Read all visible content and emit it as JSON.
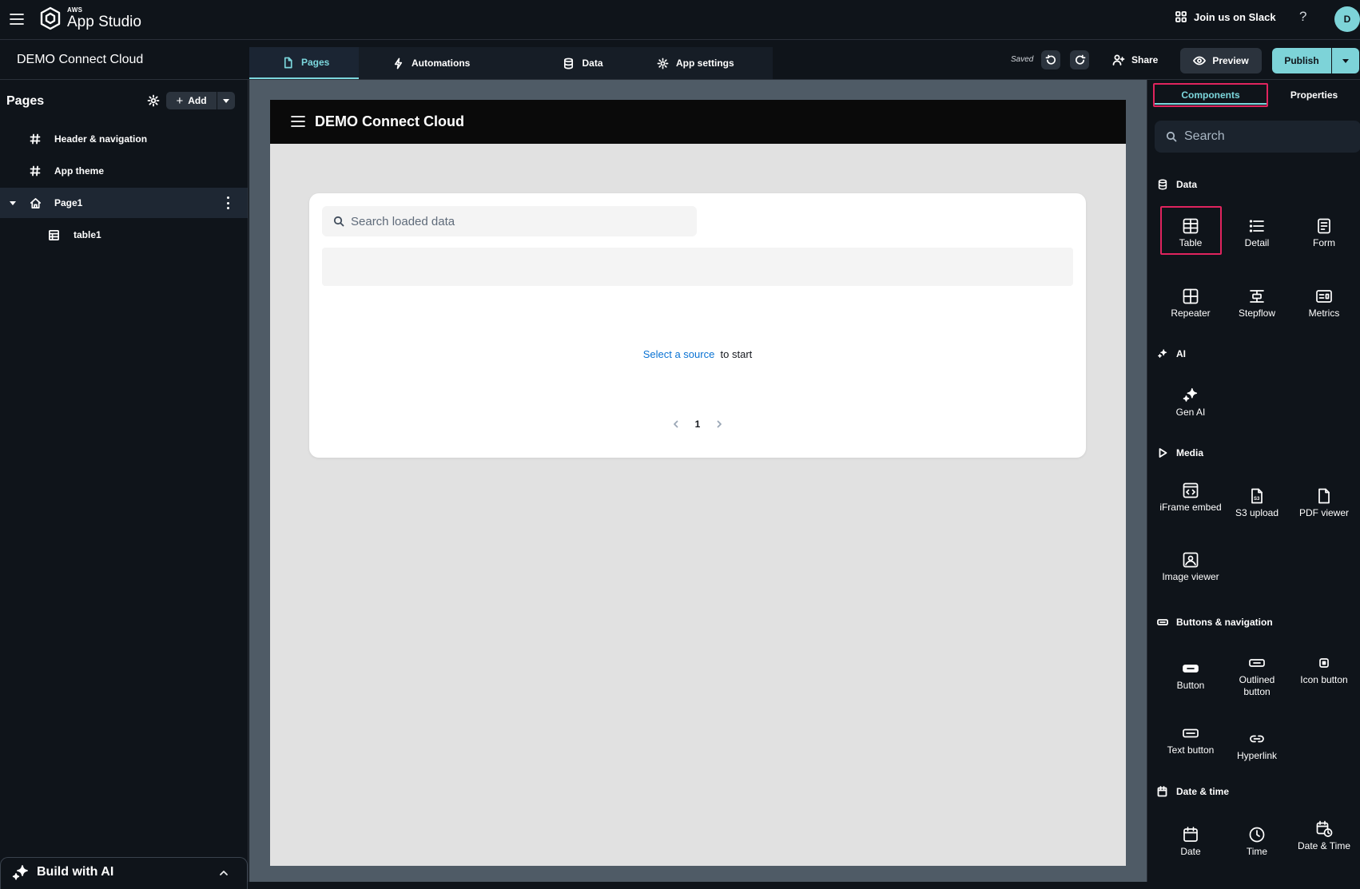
{
  "topbar": {
    "brand_small": "AWS",
    "brand_name": "App Studio",
    "slack_label": "Join us on Slack",
    "help_label": "?",
    "avatar_initial": "D"
  },
  "appbar": {
    "app_name": "DEMO Connect Cloud",
    "tabs": [
      {
        "label": "Pages",
        "icon": "page-icon",
        "active": true
      },
      {
        "label": "Automations",
        "icon": "lightning-icon"
      },
      {
        "label": "Data",
        "icon": "database-icon"
      },
      {
        "label": "App settings",
        "icon": "gear-icon"
      }
    ],
    "saved_label": "Saved",
    "share_label": "Share",
    "preview_label": "Preview",
    "publish_label": "Publish"
  },
  "left": {
    "title": "Pages",
    "add_label": "Add",
    "items": [
      {
        "label": "Header & navigation"
      },
      {
        "label": "App theme"
      },
      {
        "label": "Page1"
      },
      {
        "label": "table1"
      }
    ],
    "build_ai_label": "Build with AI"
  },
  "canvas": {
    "app_title": "DEMO Connect Cloud",
    "search_placeholder": "Search loaded data",
    "empty_link": "Select a source",
    "empty_rest": "to start",
    "page_number": "1"
  },
  "right": {
    "tabs": [
      "Components",
      "Properties"
    ],
    "search_placeholder": "Search",
    "sections": {
      "data": {
        "title": "Data",
        "items": [
          "Table",
          "Detail",
          "Form",
          "Repeater",
          "Stepflow",
          "Metrics"
        ]
      },
      "ai": {
        "title": "AI",
        "items": [
          "Gen AI"
        ]
      },
      "media": {
        "title": "Media",
        "items": [
          "iFrame embed",
          "S3 upload",
          "PDF viewer",
          "Image viewer"
        ]
      },
      "buttons": {
        "title": "Buttons & navigation",
        "items": [
          "Button",
          "Outlined button",
          "Icon button",
          "Text button",
          "Hyperlink"
        ]
      },
      "datetime": {
        "title": "Date & time",
        "items": [
          "Date",
          "Time",
          "Date & Time"
        ]
      }
    }
  },
  "colors": {
    "accent": "#7dd3d8",
    "highlight": "#e0245e",
    "link": "#0972d3",
    "background": "#0f141a"
  }
}
